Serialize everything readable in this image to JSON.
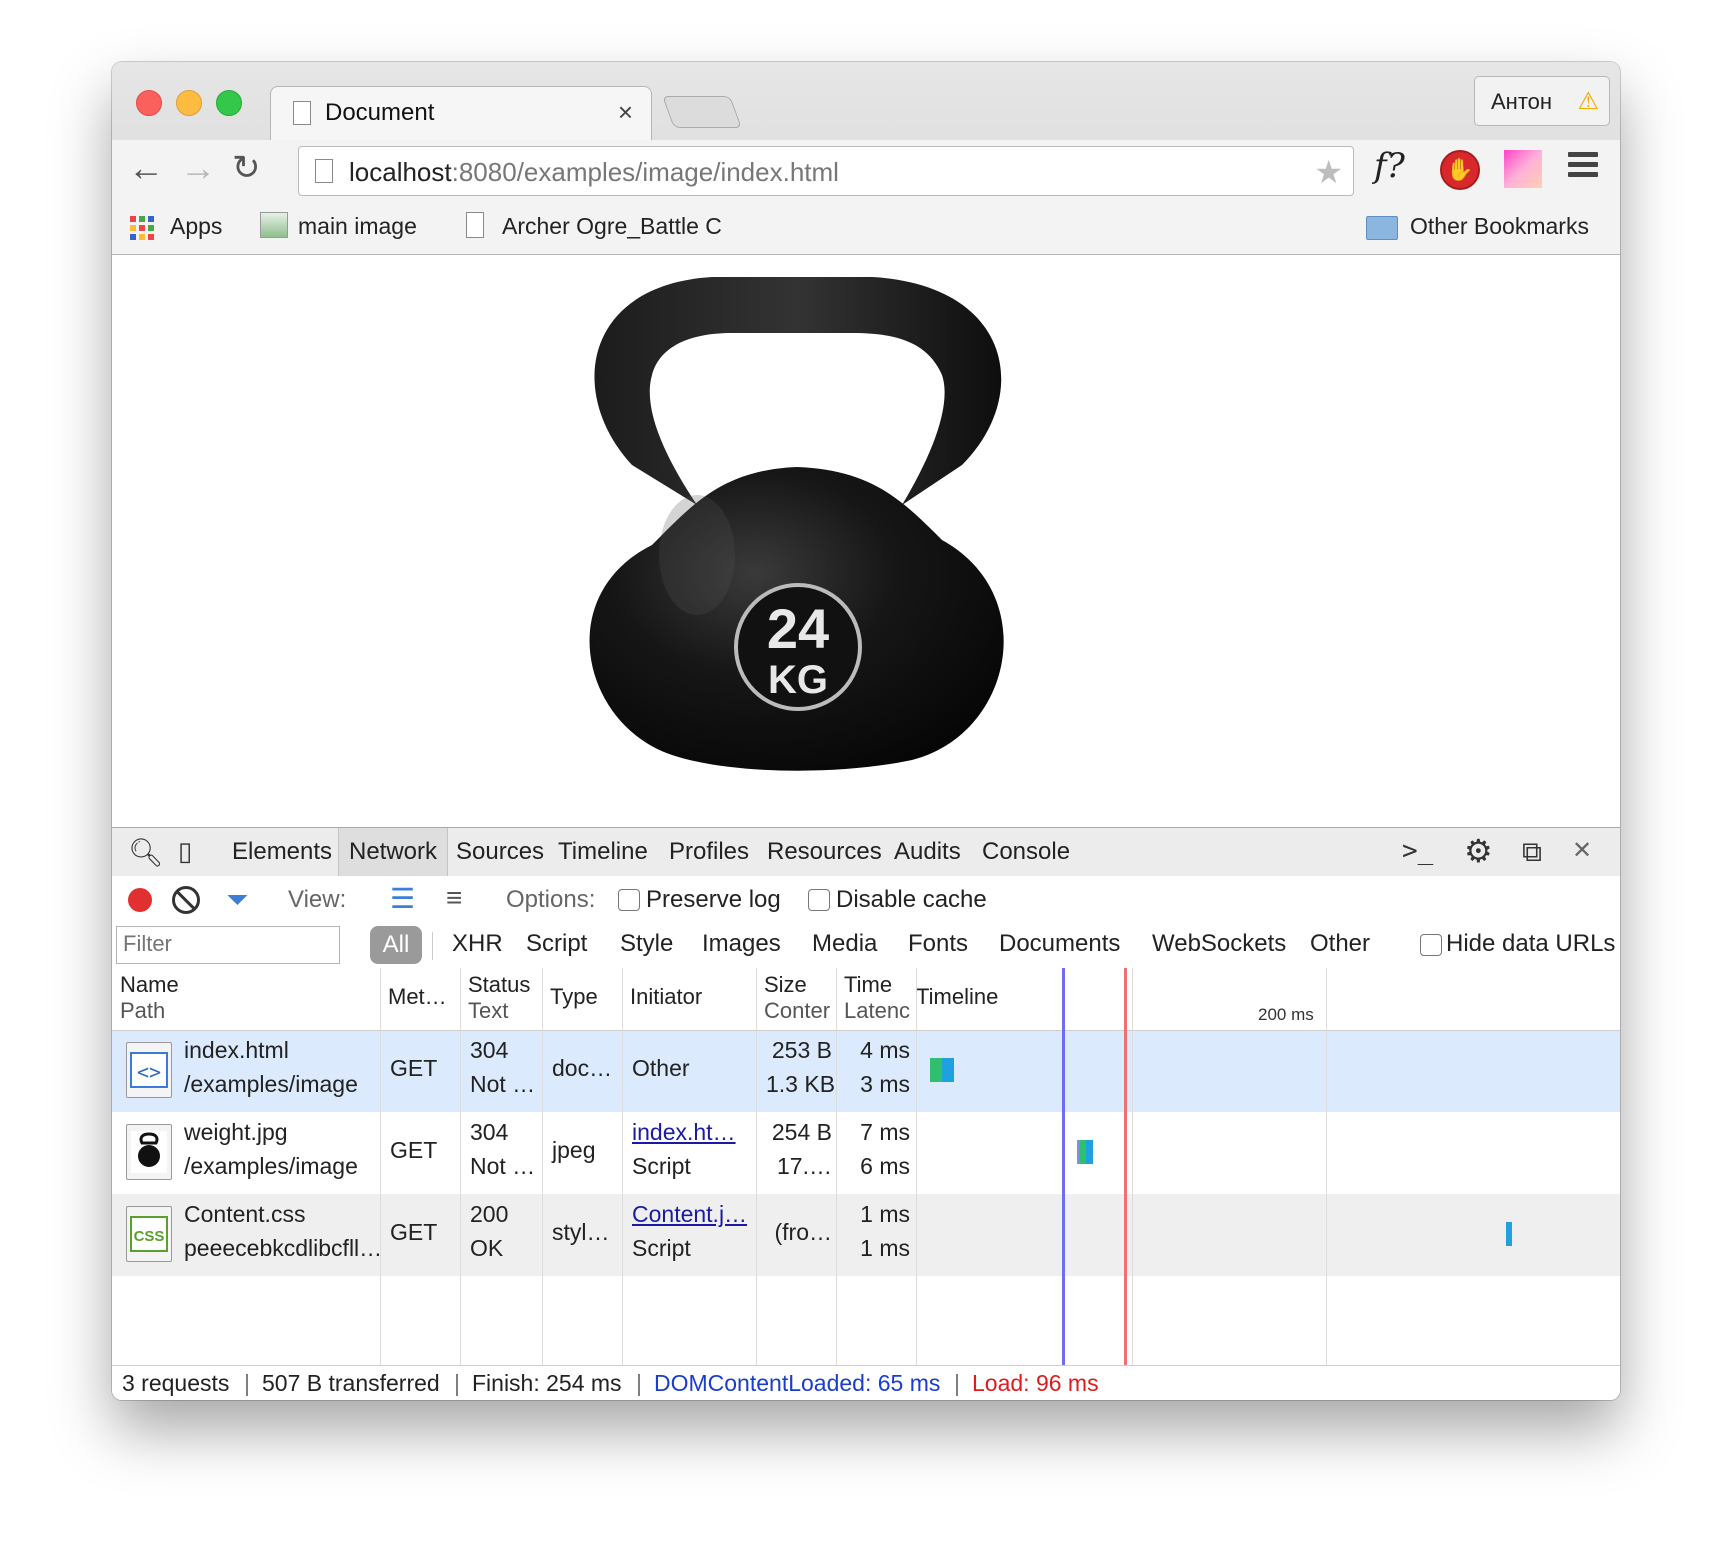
{
  "browser": {
    "tab_title": "Document",
    "tab_close": "×",
    "profile_name": "Антон",
    "profile_warning": "⚠",
    "url_host": "localhost",
    "url_rest": ":8080/examples/image/index.html",
    "ext_f_label": "f?",
    "bookmarks": [
      {
        "label": "Apps"
      },
      {
        "label": "main image"
      },
      {
        "label": "Archer Ogre_Battle C"
      }
    ],
    "other_bookmarks": "Other Bookmarks"
  },
  "page": {
    "kettlebell_number": "24",
    "kettlebell_unit": "KG"
  },
  "devtools": {
    "tabs": [
      "Elements",
      "Network",
      "Sources",
      "Timeline",
      "Profiles",
      "Resources",
      "Audits",
      "Console"
    ],
    "active_tab": "Network",
    "toolbar": {
      "view_label": "View:",
      "options_label": "Options:",
      "preserve_log": "Preserve log",
      "disable_cache": "Disable cache"
    },
    "filter": {
      "placeholder": "Filter",
      "all": "All",
      "types": [
        "XHR",
        "Script",
        "Style",
        "Images",
        "Media",
        "Fonts",
        "Documents",
        "WebSockets",
        "Other"
      ],
      "hide_data_urls": "Hide data URLs"
    },
    "columns": {
      "name": "Name",
      "path": "Path",
      "method": "Met…",
      "status": "Status",
      "status_text": "Text",
      "type": "Type",
      "initiator": "Initiator",
      "size": "Size",
      "content": "Conter",
      "time": "Time",
      "latency": "Latenc",
      "timeline": "Timeline",
      "timeline_tick": "200 ms"
    },
    "requests": [
      {
        "name": "index.html",
        "path": "/examples/image",
        "method": "GET",
        "status": "304",
        "status_text": "Not …",
        "type": "doc…",
        "initiator": "Other",
        "initiator_sub": "",
        "size": "253 B",
        "content": "1.3 KB",
        "time": "4 ms",
        "latency": "3 ms",
        "icon": "html-file-icon",
        "tl_start": 0.0,
        "tl_end": 0.04
      },
      {
        "name": "weight.jpg",
        "path": "/examples/image",
        "method": "GET",
        "status": "304",
        "status_text": "Not …",
        "type": "jpeg",
        "initiator": "index.ht…",
        "initiator_sub": "Script",
        "size": "254 B",
        "content": "17.…",
        "time": "7 ms",
        "latency": "6 ms",
        "icon": "image-file-icon",
        "tl_start": 0.245,
        "tl_end": 0.272
      },
      {
        "name": "Content.css",
        "path": "peeecebkcdlibcfll…",
        "method": "GET",
        "status": "200",
        "status_text": "OK",
        "type": "styl…",
        "initiator": "Content.j…",
        "initiator_sub": "Script",
        "size": "(fro…",
        "content": "",
        "time": "1 ms",
        "latency": "1 ms",
        "icon": "css-file-icon",
        "tl_start": 0.96,
        "tl_end": 0.97
      }
    ],
    "status_bar": {
      "requests": "3 requests",
      "transferred": "507 B transferred",
      "finish": "Finish: 254 ms",
      "dom_content_loaded": "DOMContentLoaded: 65 ms",
      "load": "Load: 96 ms"
    },
    "colors": {
      "selected_row": "#dbeafc",
      "alt_row": "#efefef",
      "dom_line": "#6e6ef0",
      "load_line": "#ee7070",
      "dom_text": "#1a3ccf",
      "load_text": "#e01b1b"
    }
  }
}
